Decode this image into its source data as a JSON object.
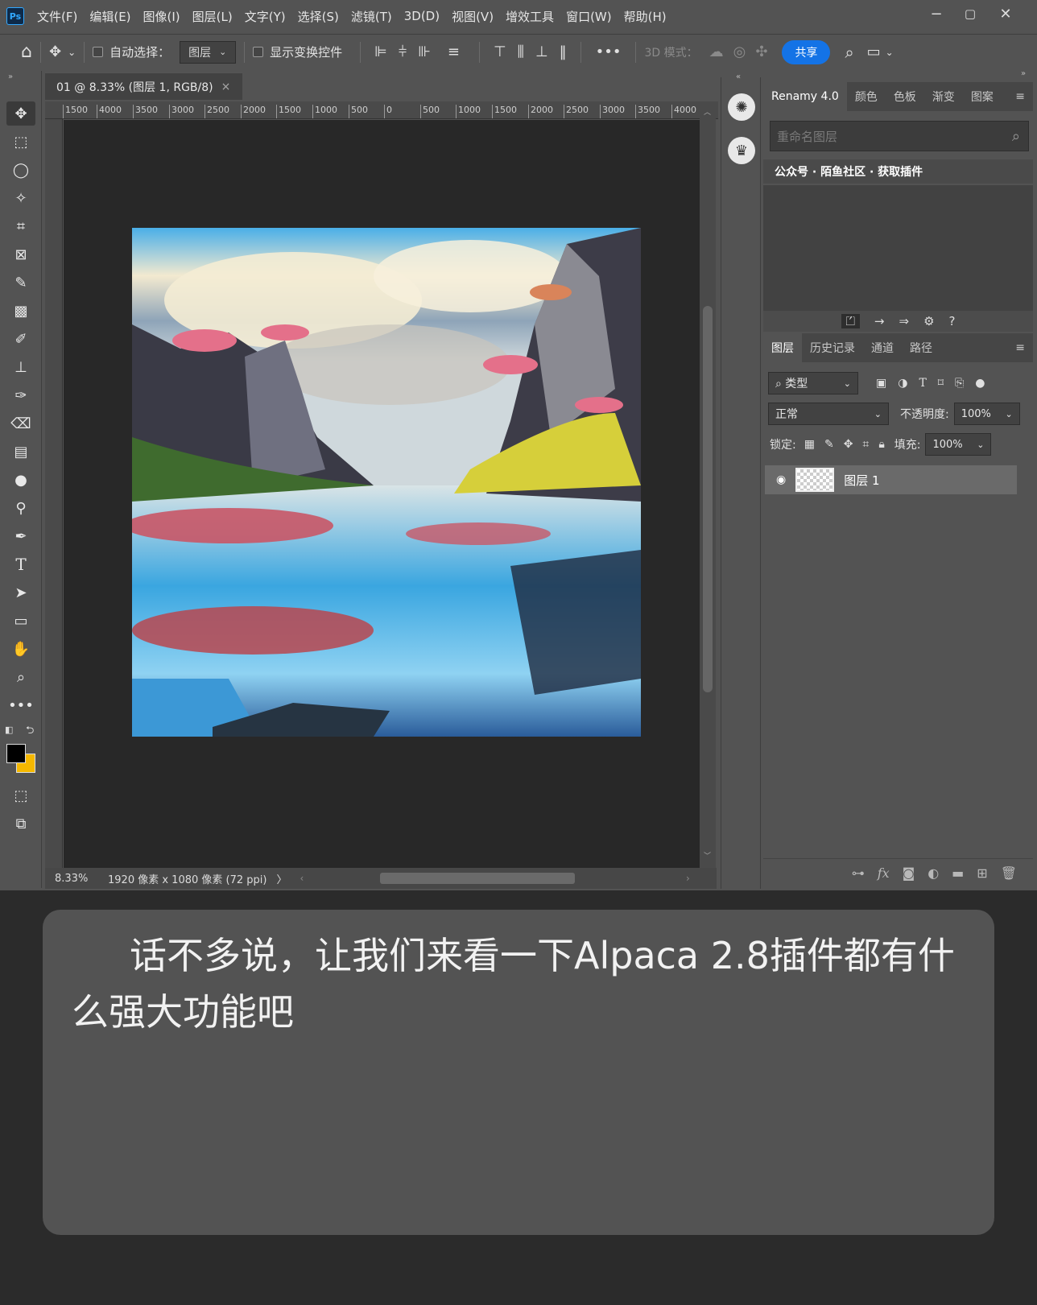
{
  "menubar": {
    "logo": "Ps",
    "items": [
      "文件(F)",
      "编辑(E)",
      "图像(I)",
      "图层(L)",
      "文字(Y)",
      "选择(S)",
      "滤镜(T)",
      "3D(D)",
      "视图(V)",
      "增效工具",
      "窗口(W)",
      "帮助(H)"
    ],
    "window": {
      "minimize": "−",
      "restore": "▢",
      "close": "✕"
    }
  },
  "options": {
    "auto_select_label": "自动选择：",
    "auto_select_value": "图层",
    "show_transform_label": "显示变换控件",
    "three_d_mode_label": "3D 模式：",
    "more": "•••",
    "share_label": "共享"
  },
  "document": {
    "tab_title": "01 @ 8.33% (图层 1, RGB/8)",
    "tab_close": "×",
    "ruler_ticks": [
      "1500",
      "4000",
      "3500",
      "3000",
      "2500",
      "2000",
      "1500",
      "1000",
      "500",
      "0",
      "500",
      "1000",
      "1500",
      "2000",
      "2500",
      "3000",
      "3500",
      "4000"
    ],
    "zoom": "8.33%",
    "dimensions": "1920 像素 x 1080 像素 (72 ppi)",
    "status_arrow": "〉"
  },
  "renamy_panel": {
    "tabs": [
      "Renamy 4.0",
      "颜色",
      "色板",
      "渐变",
      "图案"
    ],
    "search_placeholder": "重命名图层",
    "link_text": "公众号 · 陌鱼社区 · 获取插件"
  },
  "layers_panel": {
    "tabs": [
      "图层",
      "历史记录",
      "通道",
      "路径"
    ],
    "filter_label": "类型",
    "blend_mode": "正常",
    "opacity_label": "不透明度:",
    "opacity_value": "100%",
    "lock_label": "锁定:",
    "fill_label": "填充:",
    "fill_value": "100%",
    "layers": [
      {
        "name": "图层 1",
        "visible": true
      }
    ],
    "footer_fx": "fx"
  },
  "caption": {
    "text": "话不多说，让我们来看一下Alpaca 2.8插件都有什么强大功能吧"
  },
  "colors": {
    "ui_bg": "#535353",
    "canvas_bg": "#282828",
    "accent": "#1473e6",
    "foreground_swatch": "#000000",
    "background_swatch": "#f5b800"
  }
}
